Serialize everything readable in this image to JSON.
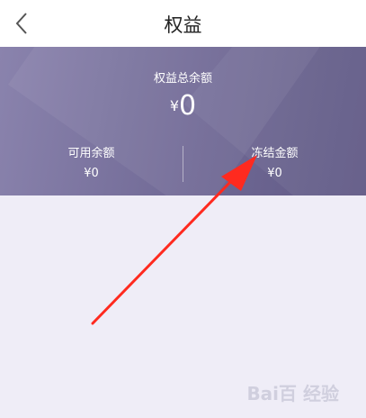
{
  "header": {
    "title": "权益"
  },
  "summary": {
    "total_label": "权益总余额",
    "total_currency": "¥",
    "total_value": "0",
    "available_label": "可用余额",
    "available_value": "¥0",
    "frozen_label": "冻结金额",
    "frozen_value": "¥0"
  },
  "icons": {
    "back": "chevron-left-icon"
  },
  "colors": {
    "card_gradient_start": "#8a83ad",
    "card_gradient_end": "#605985",
    "page_background": "#efedf7",
    "annotation_arrow": "#ff2a1f"
  },
  "watermark": {
    "text": "Bai百 经验"
  }
}
